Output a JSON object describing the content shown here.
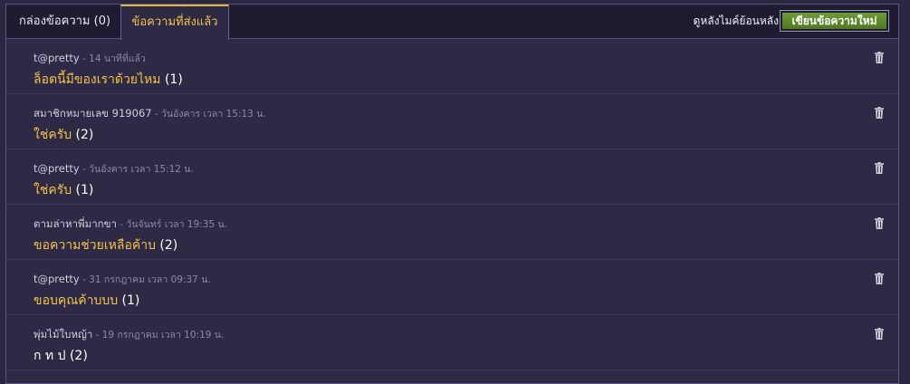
{
  "tabs": [
    {
      "label": "กล่องข้อความ (0)"
    },
    {
      "label": "ข้อความที่ส่งแล้ว"
    }
  ],
  "header": {
    "timeline_label": "ดูหลังไมค์ย้อนหลัง",
    "compose_label": "เขียนข้อความใหม่"
  },
  "messages": [
    {
      "sender": "t@pretty",
      "sep": " - ",
      "time": "14 นาทีที่แล้ว",
      "subject": "ล็อตนี้มีของเราด้วยไหม",
      "count": " (1)"
    },
    {
      "sender": "สมาชิกหมายเลข 919067",
      "sep": " - ",
      "time": "วันอังคาร เวลา 15:13 น.",
      "subject": "ใช่ครับ",
      "count": " (2)"
    },
    {
      "sender": "t@pretty",
      "sep": " - ",
      "time": "วันอังคาร เวลา 15:12 น.",
      "subject": "ใช่ครับ",
      "count": " (1)"
    },
    {
      "sender": "ตามล่าหาพี่มากขา",
      "sep": " - ",
      "time": "วันจันทร์ เวลา 19:35 น.",
      "subject": "ขอความช่วยเหลือค้าบ",
      "count": " (2)"
    },
    {
      "sender": "t@pretty",
      "sep": " - ",
      "time": "31 กรกฎาคม เวลา 09:37 น.",
      "subject": "ขอบคุณค้าบบบ",
      "count": " (1)"
    },
    {
      "sender": "พุ่มไม้ใบหญ้า",
      "sep": " - ",
      "time": "19 กรกฎาคม เวลา 10:19 น.",
      "subject": "ก ท ป",
      "count": " (2)"
    }
  ],
  "icons": {
    "delete": "trash-icon"
  },
  "colors": {
    "accent": "#f2c24a",
    "compose": "#5c8a2c",
    "background": "#2e2a45"
  }
}
